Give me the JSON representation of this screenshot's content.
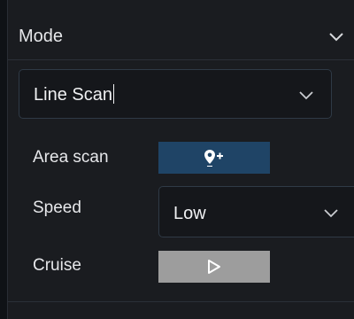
{
  "mode": {
    "title": "Mode",
    "selected": "Line Scan"
  },
  "area_scan": {
    "label": "Area scan",
    "button_icon": "location-add-icon"
  },
  "speed": {
    "label": "Speed",
    "value": "Low"
  },
  "cruise": {
    "label": "Cruise",
    "button_icon": "play-icon"
  },
  "colors": {
    "accent_button": "#1f4466",
    "disabled_button": "#9d9d9d",
    "panel_bg": "#1a1c20",
    "select_border": "#2f3a46"
  }
}
